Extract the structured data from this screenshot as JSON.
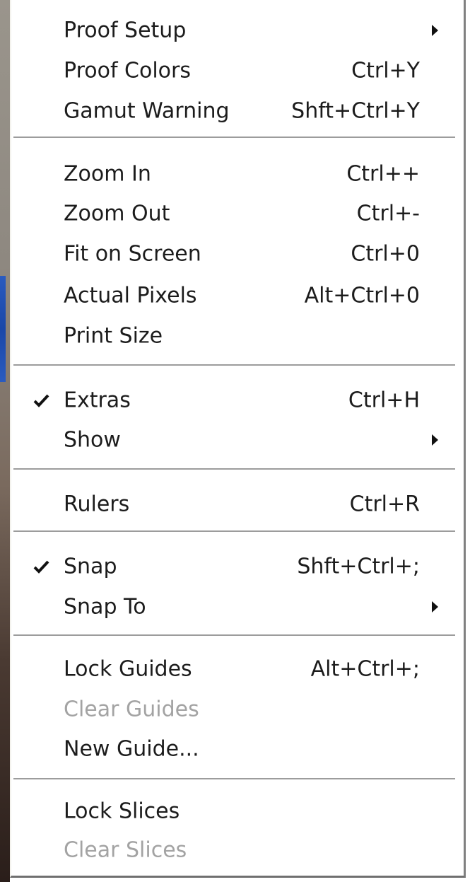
{
  "menu": {
    "items": [
      {
        "label": "Proof Setup",
        "shortcut": "",
        "submenu": true,
        "checked": false,
        "disabled": false
      },
      {
        "label": "Proof Colors",
        "shortcut": "Ctrl+Y",
        "submenu": false,
        "checked": false,
        "disabled": false
      },
      {
        "label": "Gamut Warning",
        "shortcut": "Shft+Ctrl+Y",
        "submenu": false,
        "checked": false,
        "disabled": false
      },
      {
        "label": "Zoom In",
        "shortcut": "Ctrl++",
        "submenu": false,
        "checked": false,
        "disabled": false
      },
      {
        "label": "Zoom Out",
        "shortcut": "Ctrl+-",
        "submenu": false,
        "checked": false,
        "disabled": false
      },
      {
        "label": "Fit on Screen",
        "shortcut": "Ctrl+0",
        "submenu": false,
        "checked": false,
        "disabled": false
      },
      {
        "label": "Actual Pixels",
        "shortcut": "Alt+Ctrl+0",
        "submenu": false,
        "checked": false,
        "disabled": false
      },
      {
        "label": "Print Size",
        "shortcut": "",
        "submenu": false,
        "checked": false,
        "disabled": false
      },
      {
        "label": "Extras",
        "shortcut": "Ctrl+H",
        "submenu": false,
        "checked": true,
        "disabled": false
      },
      {
        "label": "Show",
        "shortcut": "",
        "submenu": true,
        "checked": false,
        "disabled": false
      },
      {
        "label": "Rulers",
        "shortcut": "Ctrl+R",
        "submenu": false,
        "checked": false,
        "disabled": false
      },
      {
        "label": "Snap",
        "shortcut": "Shft+Ctrl+;",
        "submenu": false,
        "checked": true,
        "disabled": false
      },
      {
        "label": "Snap To",
        "shortcut": "",
        "submenu": true,
        "checked": false,
        "disabled": false
      },
      {
        "label": "Lock Guides",
        "shortcut": "Alt+Ctrl+;",
        "submenu": false,
        "checked": false,
        "disabled": false
      },
      {
        "label": "Clear Guides",
        "shortcut": "",
        "submenu": false,
        "checked": false,
        "disabled": true
      },
      {
        "label": "New Guide...",
        "shortcut": "",
        "submenu": false,
        "checked": false,
        "disabled": false
      },
      {
        "label": "Lock Slices",
        "shortcut": "",
        "submenu": false,
        "checked": false,
        "disabled": false
      },
      {
        "label": "Clear Slices",
        "shortcut": "",
        "submenu": false,
        "checked": false,
        "disabled": true
      }
    ]
  },
  "icons": {
    "check": "check-icon",
    "submenu": "submenu-arrow-icon"
  },
  "colors": {
    "text": "#1c1c1c",
    "disabled_text": "#a3a3a3",
    "background": "#ffffff",
    "separator": "#9c9c9c"
  }
}
